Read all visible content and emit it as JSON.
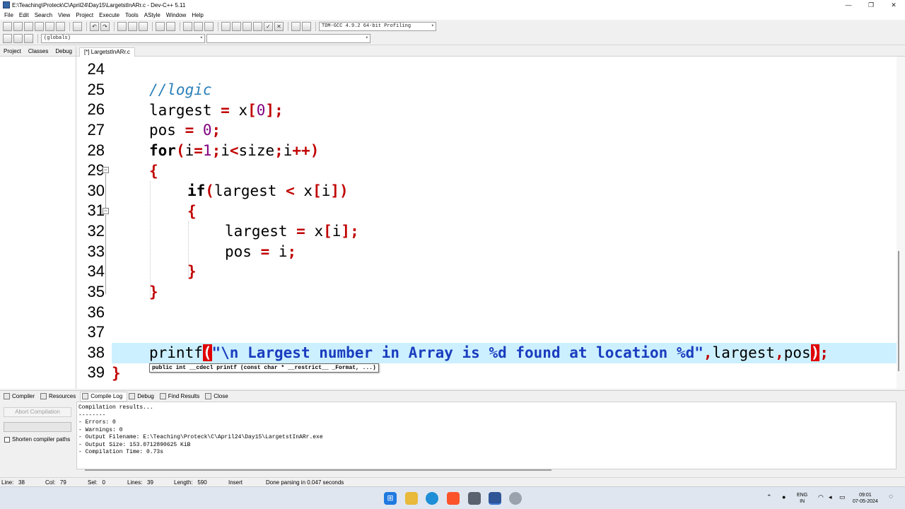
{
  "window": {
    "title": "E:\\Teaching\\Proteck\\C\\April24\\Day15\\LargetstInARr.c - Dev-C++ 5.11",
    "minimize": "—",
    "maximize": "❐",
    "close": "✕"
  },
  "menu": [
    "File",
    "Edit",
    "Search",
    "View",
    "Project",
    "Execute",
    "Tools",
    "AStyle",
    "Window",
    "Help"
  ],
  "toolbar": {
    "compiler_select": "TDM-GCC 4.9.2 64-bit Profiling",
    "scope_select": "(globals)"
  },
  "left_panel": {
    "tabs": [
      "Project",
      "Classes",
      "Debug"
    ]
  },
  "editor": {
    "tab_label": "[*] LargetstInARr.c",
    "line_numbers": [
      "24",
      "25",
      "26",
      "27",
      "28",
      "29",
      "30",
      "31",
      "32",
      "33",
      "34",
      "35",
      "36",
      "37",
      "38",
      "39"
    ],
    "lines": {
      "l25": "//logic",
      "l26a": "largest ",
      "l26b": "=",
      "l26c": " x",
      "l26d": "[",
      "l26e": "0",
      "l26f": "];",
      "l27a": "pos ",
      "l27b": "=",
      "l27c": " ",
      "l27d": "0",
      "l27e": ";",
      "l28a": "for",
      "l28b": "(",
      "l28c": "i",
      "l28d": "=",
      "l28e": "1",
      "l28f": ";",
      "l28g": "i",
      "l28h": "<",
      "l28i": "size",
      "l28j": ";",
      "l28k": "i",
      "l28l": "++",
      "l28m": ")",
      "l29": "{",
      "l30a": "if",
      "l30b": "(",
      "l30c": "largest ",
      "l30d": "<",
      "l30e": " x",
      "l30f": "[",
      "l30g": "i",
      "l30h": "])",
      "l31": "{",
      "l32a": "largest ",
      "l32b": "=",
      "l32c": " x",
      "l32d": "[",
      "l32e": "i",
      "l32f": "];",
      "l33a": "pos ",
      "l33b": "=",
      "l33c": " i",
      "l33d": ";",
      "l34": "}",
      "l35": "}",
      "l38a": "printf",
      "l38b": "(",
      "l38c": "\"\\n Largest number in Array is %d found at location %d\"",
      "l38d": ",",
      "l38e": "largest",
      "l38f": ",",
      "l38g": "pos",
      "l38h": ")",
      "l38i": ";",
      "l39": "}"
    },
    "tooltip": "public int __cdecl printf (const char * __restrict__ _Format, ...)"
  },
  "bottom_panel": {
    "tabs": [
      "Compiler",
      "Resources",
      "Compile Log",
      "Debug",
      "Find Results",
      "Close"
    ],
    "abort_label": "Abort Compilation",
    "shorten_label": "Shorten compiler paths",
    "log": [
      "Compilation results...",
      "--------",
      "- Errors: 0",
      "- Warnings: 0",
      "- Output Filename: E:\\Teaching\\Proteck\\C\\April24\\Day15\\LargetstInARr.exe",
      "- Output Size: 153.0712890625 KiB",
      "- Compilation Time: 0.73s"
    ]
  },
  "status": {
    "line": "Line:   38",
    "col": "Col:   79",
    "sel": "Sel:   0",
    "lines": "Lines:   39",
    "length": "Length:   590",
    "mode": "Insert",
    "message": "Done parsing in 0.047 seconds"
  },
  "taskbar": {
    "lang1": "ENG",
    "lang2": "IN",
    "time": "09:01",
    "date": "07-05-2024"
  }
}
